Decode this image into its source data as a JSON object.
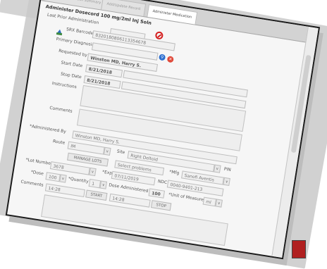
{
  "tabs": [
    {
      "label": "Administered Meds Summary"
    },
    {
      "label": "Add/Update Record"
    },
    {
      "label": "Administer Medication"
    }
  ],
  "form": {
    "title": "Administer Dosecord 100 mg/2ml Inj Soln",
    "last_prior_admin_label": "Last Prior Administration",
    "srx_barcode_label": "SRX Barcode",
    "srx_barcode_value": "8320180806113354678",
    "primary_diagnosis_label": "Primary Diagnosis",
    "requested_by_label": "Requested by",
    "requested_by_value": "Winston MD, Harry S.",
    "start_date_label": "Start Date",
    "start_date_value": "8/21/2018",
    "stop_date_label": "Stop Date",
    "stop_date_value": "8/21/2018",
    "instructions_label": "Instructions",
    "comments_label": "Comments",
    "administered_by_label": "*Administered By",
    "administered_by_value": "Winston MD, Harry S.",
    "route_label": "Route",
    "route_value": "IM",
    "site_label": "Site",
    "site_value": "Right Deltoid",
    "problems_placeholder": "Select problems",
    "mfg_label": "*Mfg",
    "mfg_value": "Sanofi Aventis",
    "manage_lots_label": "MANAGE LOTS",
    "lot_number_label": "*Lot Number",
    "lot_number_value": "3678",
    "exp_label": "*Exp",
    "exp_value": "07/11/2019",
    "ndc_label": "NDC",
    "ndc_value": "0040-9401-213",
    "dose_label": "*Dose",
    "dose_value": "100",
    "quantity_label": "*Quantity",
    "quantity_value": "1",
    "dose_administered_label": "Dose Administered",
    "dose_administered_value": "100",
    "unit_of_measure_label": "*Unit of Measure",
    "unit_of_measure_value": "ml",
    "start_time_value": "14:28",
    "start_button": "START",
    "stop_time_value": "14:28",
    "stop_button": "STOP",
    "comments2_label": "Comments",
    "pin_label": "PIN"
  }
}
